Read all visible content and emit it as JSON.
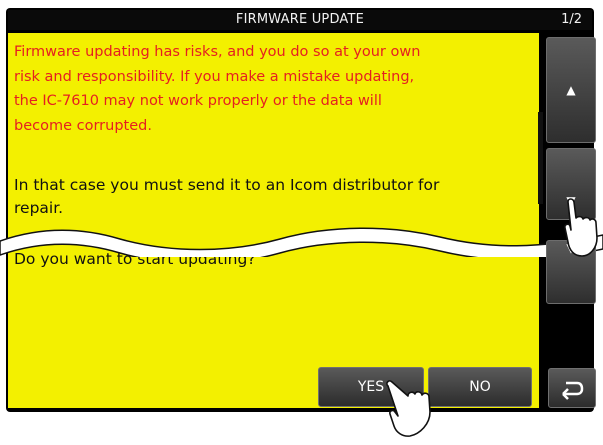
{
  "header": {
    "title": "FIRMWARE UPDATE",
    "page": "1/2"
  },
  "dialog": {
    "warning_lines": [
      "Firmware updating has risks, and you do so at your own",
      "risk and responsibility. If you make a mistake updating,",
      "the IC-7610 may not work properly or the data will",
      "become corrupted."
    ],
    "line_repair_1": "In that case you must send it to an Icom distributor for",
    "line_repair_2": "repair.",
    "question": "Do you want to start updating?"
  },
  "buttons": {
    "yes_label": "YES",
    "no_label": "NO"
  },
  "icons": {
    "scroll_up": "triangle-up-icon",
    "scroll_down": "triangle-down-icon",
    "back": "return-arrow-icon",
    "touch": "pointing-hand-icon"
  },
  "colors": {
    "panel": "#f3f000",
    "warning_text": "#e52020",
    "screen": "#000000"
  }
}
